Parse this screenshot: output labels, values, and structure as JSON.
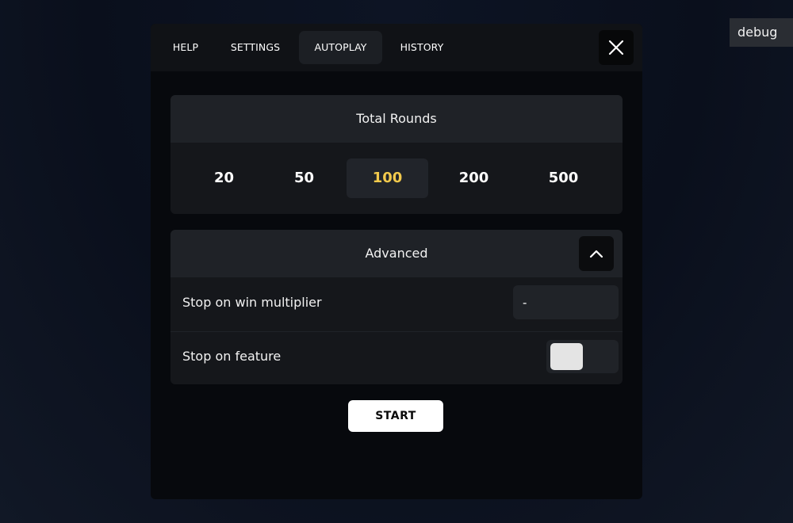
{
  "debug_label": "debug",
  "tabs": [
    {
      "label": "HELP"
    },
    {
      "label": "SETTINGS"
    },
    {
      "label": "AUTOPLAY",
      "active": true
    },
    {
      "label": "HISTORY"
    }
  ],
  "close_icon": "close-icon",
  "total_rounds": {
    "title": "Total Rounds",
    "options": [
      "20",
      "50",
      "100",
      "200",
      "500"
    ],
    "selected": "100",
    "selected_color": "#f2c94c"
  },
  "advanced": {
    "title": "Advanced",
    "collapse_icon": "chevron-up-icon",
    "stop_on_win_multiplier": {
      "label": "Stop on win multiplier",
      "value": "-"
    },
    "stop_on_feature": {
      "label": "Stop on feature",
      "enabled": false
    }
  },
  "start_label": "START"
}
